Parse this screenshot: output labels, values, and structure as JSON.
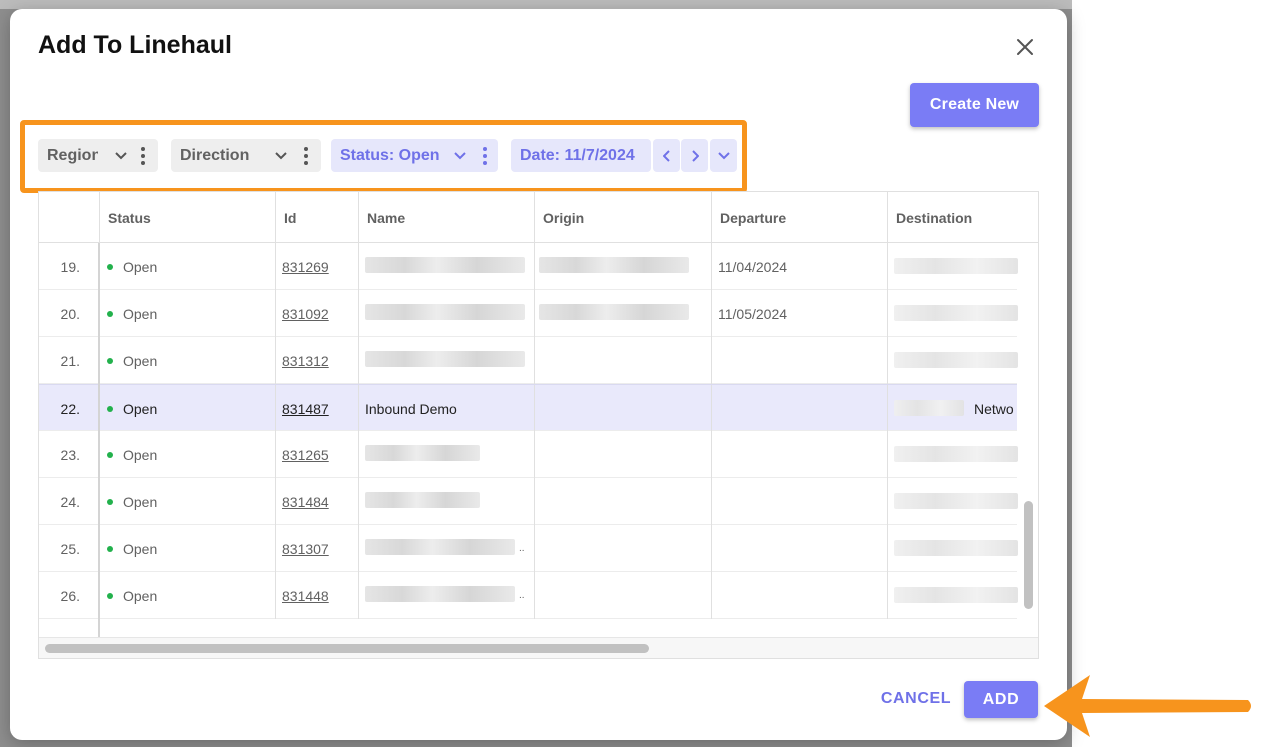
{
  "modal": {
    "title": "Add To Linehaul",
    "create_new_label": "Create New",
    "cancel_label": "CANCEL",
    "add_label": "ADD"
  },
  "filters": {
    "region": "Region",
    "direction": "Direction",
    "status": "Status: Open",
    "date": "Date: 11/7/2024"
  },
  "grid": {
    "columns": [
      "Status",
      "Id",
      "Name",
      "Origin",
      "Departure",
      "Destination"
    ],
    "rows": [
      {
        "num": "19.",
        "status": "Open",
        "id": "831269",
        "name": "",
        "departure": "11/04/2024",
        "destination": ""
      },
      {
        "num": "20.",
        "status": "Open",
        "id": "831092",
        "name": "",
        "departure": "11/05/2024",
        "destination": ""
      },
      {
        "num": "21.",
        "status": "Open",
        "id": "831312",
        "name": "",
        "departure": "",
        "destination": ""
      },
      {
        "num": "22.",
        "status": "Open",
        "id": "831487",
        "name": "Inbound Demo",
        "departure": "",
        "destination": "Netwo",
        "selected": true
      },
      {
        "num": "23.",
        "status": "Open",
        "id": "831265",
        "name": "",
        "departure": "",
        "destination": ""
      },
      {
        "num": "24.",
        "status": "Open",
        "id": "831484",
        "name": "",
        "departure": "",
        "destination": ""
      },
      {
        "num": "25.",
        "status": "Open",
        "id": "831307",
        "name": "..",
        "departure": "",
        "destination": ""
      },
      {
        "num": "26.",
        "status": "Open",
        "id": "831448",
        "name": "..",
        "departure": "",
        "destination": ""
      }
    ]
  },
  "colors": {
    "accent": "#7a7cf5",
    "highlight": "#f7941d",
    "status_open": "#22b14c"
  }
}
